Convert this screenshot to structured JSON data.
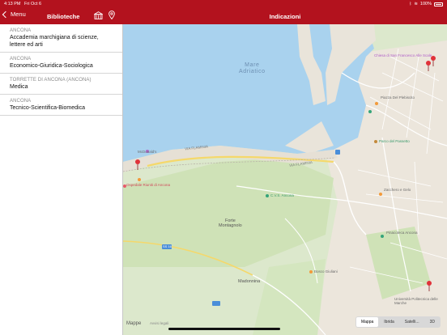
{
  "status": {
    "time": "4:13 PM",
    "date": "Fri Oct 6",
    "battery": "100%"
  },
  "nav": {
    "back_label": "Menu",
    "title_left": "Biblioteche",
    "title_right": "Indicazioni",
    "icons": [
      "back-chevron-icon",
      "library-building-icon",
      "location-pin-icon"
    ]
  },
  "libraries": [
    {
      "city": "ANCONA",
      "name": "Accademia marchigiana di scienze, lettere ed arti"
    },
    {
      "city": "ANCONA",
      "name": "Economico-Giuridica-Sociologica"
    },
    {
      "city": "TORRETTE DI ANCONA (ANCONA)",
      "name": "Medica"
    },
    {
      "city": "ANCONA",
      "name": "Tecnico-Scientifica-Biomedica"
    }
  ],
  "map": {
    "sea_label": [
      "Mare",
      "Adriatico"
    ],
    "towns": {
      "forte": [
        "Forte",
        "Montagnolo"
      ],
      "madonnina": "Madonnina"
    },
    "pois": {
      "mcdonalds": "McDonald's",
      "ospedale": "Ospedale Riuniti di Ancona",
      "chiesa": "Chiesa di San Francesco Alle Scale",
      "piazza": "Piazza Del Plebiscito",
      "passetto": "Parco del Passetto",
      "cav": "C.V.S. Ancona",
      "zacchero": "Zacchero e Gelo",
      "pinacoteca": "Pinacoteca Ancona",
      "bosco": "Bosco Giuliani",
      "universita": "Università Politecnica delle Marche"
    },
    "roads": {
      "flaminia": "VIA FLAMINIA",
      "flaminia2": "VIA FLAMINIA",
      "sp": "SS 16"
    },
    "attribution": "Mappe",
    "legal": "Avvisi legali",
    "map_types": [
      "Mappa",
      "Ibrida",
      "Satelli...",
      "3D"
    ],
    "selected_type": "Mappa"
  }
}
